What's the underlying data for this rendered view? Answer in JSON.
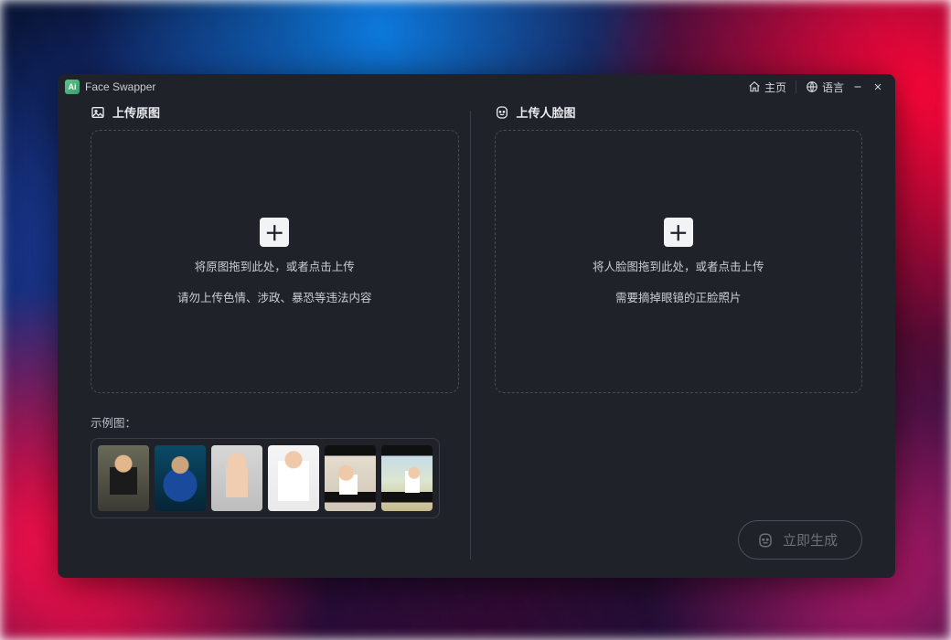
{
  "titlebar": {
    "app_icon_text": "Ai",
    "app_name": "Face Swapper",
    "home_label": "主页",
    "language_label": "语言"
  },
  "left": {
    "heading": "上传原图",
    "drop_line1": "将原图拖到此处，或者点击上传",
    "drop_line2": "请勿上传色情、涉政、暴恐等违法内容",
    "examples_label": "示例图："
  },
  "right": {
    "heading": "上传人脸图",
    "drop_line1": "将人脸图拖到此处，或者点击上传",
    "drop_line2": "需要摘掉眼镜的正脸照片"
  },
  "generate_label": "立即生成"
}
